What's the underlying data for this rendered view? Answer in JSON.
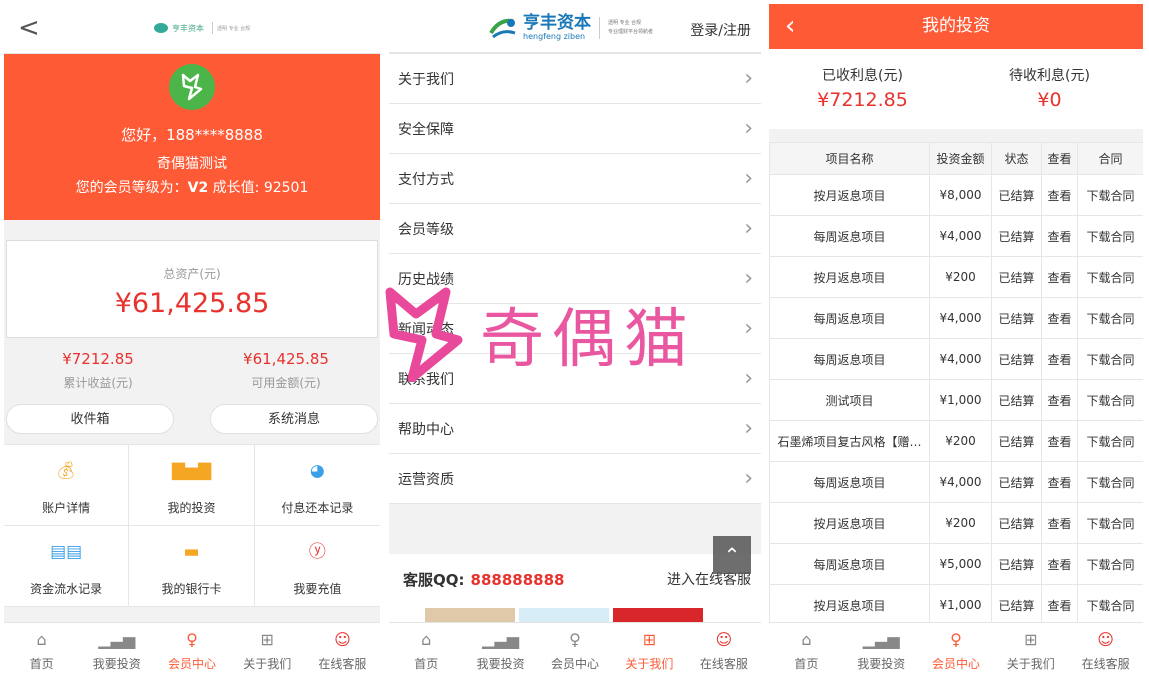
{
  "panel1": {
    "back": "<",
    "greeting": "您好，188****8888",
    "nickname": "奇偶猫测试",
    "level_prefix": "您的会员等级为：",
    "level": "V2",
    "growth_label": "成长值:",
    "growth_value": "92501",
    "total_assets_label": "总资产(元)",
    "total_assets": "¥61,425.85",
    "accum_income": "¥7212.85",
    "accum_income_label": "累计收益(元)",
    "available": "¥61,425.85",
    "available_label": "可用金额(元)",
    "tab_inbox": "收件箱",
    "tab_sysmsg": "系统消息",
    "grid": [
      {
        "label": "账户详情",
        "icon": "money-bag-icon",
        "color": "#f5a623"
      },
      {
        "label": "我的投资",
        "icon": "bar-chart-icon",
        "color": "#f5a623"
      },
      {
        "label": "付息还本记录",
        "icon": "pie-chart-icon",
        "color": "#3aa0e8"
      },
      {
        "label": "资金流水记录",
        "icon": "book-icon",
        "color": "#3aa0e8"
      },
      {
        "label": "我的银行卡",
        "icon": "card-icon",
        "color": "#f5a623"
      },
      {
        "label": "我要充值",
        "icon": "yen-icon",
        "color": "#e8322d"
      }
    ]
  },
  "nav": [
    "首页",
    "我要投资",
    "会员中心",
    "关于我们",
    "在线客服"
  ],
  "panel2": {
    "brand_cn": "亨丰资本",
    "brand_py": "hengfeng ziben",
    "slogan1": "透明 专业 合规",
    "slogan2": "专业理财平台领航者",
    "login": "登录/注册",
    "menu": [
      "关于我们",
      "安全保障",
      "支付方式",
      "会员等级",
      "历史战绩",
      "新闻动态",
      "联系我们",
      "帮助中心",
      "运营资质"
    ],
    "qq_label": "客服QQ:",
    "qq_number": "888888888",
    "enter_service": "进入在线客服"
  },
  "watermark": "奇偶猫",
  "panel3": {
    "title": "我的投资",
    "received_label": "已收利息(元)",
    "received": "¥7212.85",
    "pending_label": "待收利息(元)",
    "pending": "¥0",
    "headers": [
      "项目名称",
      "投资金额",
      "状态",
      "查看",
      "合同"
    ],
    "rows": [
      [
        "按月返息项目",
        "¥8,000",
        "已结算",
        "查看",
        "下载合同"
      ],
      [
        "每周返息项目",
        "¥4,000",
        "已结算",
        "查看",
        "下载合同"
      ],
      [
        "按月返息项目",
        "¥200",
        "已结算",
        "查看",
        "下载合同"
      ],
      [
        "每周返息项目",
        "¥4,000",
        "已结算",
        "查看",
        "下载合同"
      ],
      [
        "每周返息项目",
        "¥4,000",
        "已结算",
        "查看",
        "下载合同"
      ],
      [
        "测试项目",
        "¥1,000",
        "已结算",
        "查看",
        "下载合同"
      ],
      [
        "石墨烯项目复古风格【赠…",
        "¥200",
        "已结算",
        "查看",
        "下载合同"
      ],
      [
        "每周返息项目",
        "¥4,000",
        "已结算",
        "查看",
        "下载合同"
      ],
      [
        "按月返息项目",
        "¥200",
        "已结算",
        "查看",
        "下载合同"
      ],
      [
        "每周返息项目",
        "¥5,000",
        "已结算",
        "查看",
        "下载合同"
      ],
      [
        "按月返息项目",
        "¥1,000",
        "已结算",
        "查看",
        "下载合同"
      ]
    ]
  }
}
